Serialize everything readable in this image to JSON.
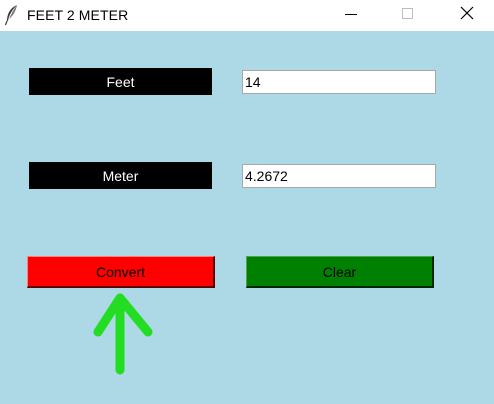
{
  "window": {
    "title": "FEET 2 METER",
    "background": "#add8e6",
    "controls": {
      "minimize_icon": "minimize-icon",
      "maximize_icon": "maximize-icon",
      "close_icon": "close-icon"
    },
    "app_icon": "feather-icon"
  },
  "form": {
    "feet_label": "Feet",
    "feet_value": "14",
    "meter_label": "Meter",
    "meter_value": "4.2672"
  },
  "buttons": {
    "convert_label": "Convert",
    "convert_color": "#ff0000",
    "clear_label": "Clear",
    "clear_color": "#008000"
  },
  "annotation": {
    "icon": "up-arrow-icon",
    "color": "#22dd22"
  }
}
